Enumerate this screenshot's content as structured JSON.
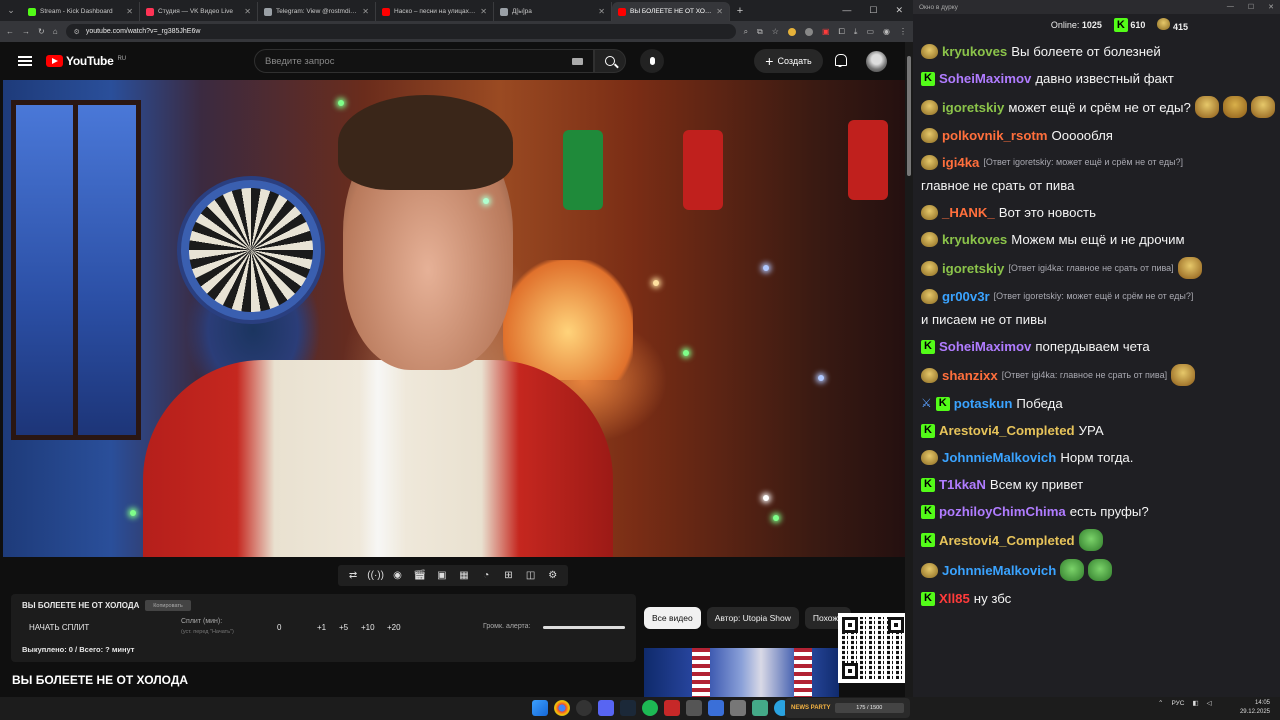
{
  "browser": {
    "tabs": [
      {
        "title": "Stream - Kick Dashboard",
        "color": "#53fc18"
      },
      {
        "title": "Студия — VK Видео Live",
        "color": "#ff3355"
      },
      {
        "title": "Telegram: View @rostmdivision",
        "color": "#9aa0a6"
      },
      {
        "title": "Наско – песни на улицах, арс...",
        "color": "#ff0000"
      },
      {
        "title": "Д[ы]ра",
        "color": "#9aa0a6"
      },
      {
        "title": "ВЫ БОЛЕЕТЕ НЕ ОТ ХОЛОДА",
        "color": "#ff0000"
      }
    ],
    "url": "youtube.com/watch?v=_rg385JhE6w"
  },
  "youtube": {
    "logo_text": "YouTube",
    "region": "RU",
    "search_placeholder": "Введите запрос",
    "create_label": "Создать",
    "video_title": "ВЫ БОЛЕЕТЕ НЕ ОТ ХОЛОДА",
    "chips": [
      "Все видео",
      "Автор: Utopia Show",
      "Похожи"
    ]
  },
  "extension": {
    "title": "ВЫ БОЛЕЕТЕ НЕ ОТ ХОЛОДА",
    "copy_label": "Копировать",
    "start_label": "НАЧАТЬ СПЛИТ",
    "split_label": "Сплит (мин):",
    "split_hint": "(уст. перед \"Начать\")",
    "split_value": "0",
    "steps": [
      "+1",
      "+5",
      "+10",
      "+20"
    ],
    "volume_label": "Громк. алерта:",
    "volume_level": 1.0,
    "status": "Выкуплено: 0 / Всего: ? минут"
  },
  "chat": {
    "window_title": "Окно в дурку",
    "online_label": "Online:",
    "online_count": "1025",
    "kick_count": "610",
    "other_count": "415",
    "messages": [
      {
        "user": "kryukoves",
        "color": "#8bc34a",
        "badge": "emote",
        "reply": "",
        "text": "Вы болеете от болезней"
      },
      {
        "user": "SoheiMaximov",
        "color": "#b07cff",
        "badge": "kick",
        "reply": "",
        "text": "давно известный факт"
      },
      {
        "user": "igoretskiy",
        "color": "#8bc34a",
        "badge": "emote",
        "reply": "",
        "text": "может ещё и срём не от еды?"
      },
      {
        "user": "polkovnik_rsotm",
        "color": "#ff6f3c",
        "badge": "emote",
        "reply": "",
        "text": "Оооообля"
      },
      {
        "user": "igi4ka",
        "color": "#ff6f3c",
        "badge": "emote",
        "reply": "[Ответ igoretskiy: может ещё и срём не от еды?]",
        "text": "главное не срать от пива"
      },
      {
        "user": "_HANK_",
        "color": "#ff6f3c",
        "badge": "emote",
        "reply": "",
        "text": "Вот это новость"
      },
      {
        "user": "kryukoves",
        "color": "#8bc34a",
        "badge": "emote",
        "reply": "",
        "text": "Можем мы ещё и не дрочим"
      },
      {
        "user": "igoretskiy",
        "color": "#8bc34a",
        "badge": "emote",
        "reply": "[Ответ igi4ka: главное не срать от пива]",
        "text": ""
      },
      {
        "user": "gr00v3r",
        "color": "#3aa3ff",
        "badge": "emote",
        "reply": "[Ответ igoretskiy: может ещё и срём не от еды?]",
        "text": "и писаем не от пивы"
      },
      {
        "user": "SoheiMaximov",
        "color": "#b07cff",
        "badge": "kick",
        "reply": "",
        "text": "попердываем чета"
      },
      {
        "user": "shanzixx",
        "color": "#ff6f3c",
        "badge": "emote",
        "reply": "[Ответ igi4ka: главное не срать от пива]",
        "text": ""
      },
      {
        "user": "potaskun",
        "color": "#3aa3ff",
        "badge": "sword-kick",
        "reply": "",
        "text": "Победа"
      },
      {
        "user": "Arestovi4_Completed",
        "color": "#e6c35a",
        "badge": "kick",
        "reply": "",
        "text": "УРА"
      },
      {
        "user": "JohnnieMalkovich",
        "color": "#3aa3ff",
        "badge": "emote",
        "reply": "",
        "text": "Норм тогда."
      },
      {
        "user": "T1kkaN",
        "color": "#b07cff",
        "badge": "kick",
        "reply": "",
        "text": "Всем ку привет"
      },
      {
        "user": "pozhiloyChimChima",
        "color": "#b07cff",
        "badge": "kick",
        "reply": "",
        "text": "есть пруфы?"
      },
      {
        "user": "Arestovi4_Completed",
        "color": "#e6c35a",
        "badge": "kick",
        "reply": "",
        "text": ""
      },
      {
        "user": "JohnnieMalkovich",
        "color": "#3aa3ff",
        "badge": "emote",
        "reply": "",
        "text": ""
      },
      {
        "user": "Xll85",
        "color": "#ff3b3b",
        "badge": "kick",
        "reply": "",
        "text": "ну збс"
      }
    ]
  },
  "taskbar": {
    "widget_name": "NEWS PARTY",
    "widget_progress": "175 / 1500",
    "lang": "РУС",
    "time": "14:05",
    "date": "29.12.2025"
  },
  "colors": {
    "kick_green": "#53fc18",
    "youtube_red": "#ff0000"
  }
}
